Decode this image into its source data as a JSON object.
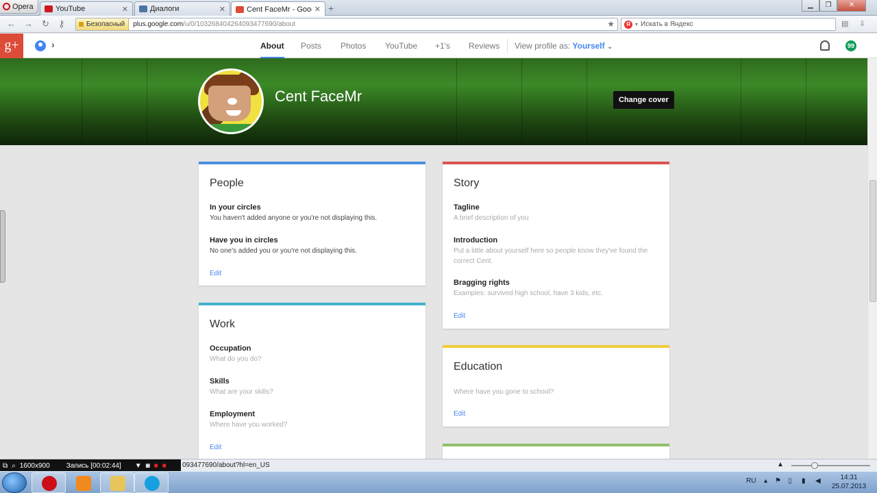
{
  "browser": {
    "menu_label": "Opera",
    "tabs": [
      {
        "label": "YouTube",
        "color": "#cc181e"
      },
      {
        "label": "Диалоги",
        "color": "#4c75a3"
      },
      {
        "label": "Cent FaceMr - Google+",
        "color": "#dd4b39"
      }
    ],
    "new_tab_icon": "plus-icon",
    "security_label": "Безопасный",
    "url_host": "plus.google.com",
    "url_path": "/u/0/103268404264093477690/about",
    "search_placeholder": "Искать в Яндекс",
    "search_engine_label": "Я"
  },
  "gplus": {
    "logo_text": "g+",
    "nav": [
      {
        "label": "About",
        "active": true
      },
      {
        "label": "Posts"
      },
      {
        "label": "Photos"
      },
      {
        "label": "YouTube"
      },
      {
        "label": "+1's"
      },
      {
        "label": "Reviews"
      }
    ],
    "view_profile_label": "View profile as:",
    "view_profile_value": "Yourself",
    "hangout_badge": "99"
  },
  "profile": {
    "name": "Cent FaceMr",
    "change_cover_label": "Change cover"
  },
  "cards": {
    "people": {
      "title": "People",
      "color": "#4a8ee0",
      "in_circles_title": "In your circles",
      "in_circles_text": "You haven't added anyone or you're not displaying this.",
      "have_you_title": "Have you in circles",
      "have_you_text": "No one's added you or you're not displaying this.",
      "edit": "Edit"
    },
    "work": {
      "title": "Work",
      "color": "#40b3cf",
      "occupation_title": "Occupation",
      "occupation_ph": "What do you do?",
      "skills_title": "Skills",
      "skills_ph": "What are your skills?",
      "employment_title": "Employment",
      "employment_ph": "Where have you worked?",
      "edit": "Edit"
    },
    "story": {
      "title": "Story",
      "color": "#d9534f",
      "tagline_title": "Tagline",
      "tagline_ph": "A brief description of you",
      "intro_title": "Introduction",
      "intro_ph": "Put a little about yourself here so people know they've found the correct Cent.",
      "bragging_title": "Bragging rights",
      "bragging_ph": "Examples: survived high school, have 3 kids, etc.",
      "edit": "Edit"
    },
    "education": {
      "title": "Education",
      "color": "#f1cd3c",
      "placeholder": "Where have you gone to school?",
      "edit": "Edit"
    },
    "next": {
      "color": "#8fbf6a"
    }
  },
  "status": {
    "recorder_res": "1600x900",
    "recorder_time": "Запись [00:02:44]",
    "hover_url": "093477690/about?hl=en_US"
  },
  "taskbar": {
    "lang": "RU",
    "time": "14:31",
    "date": "25.07.2013"
  }
}
